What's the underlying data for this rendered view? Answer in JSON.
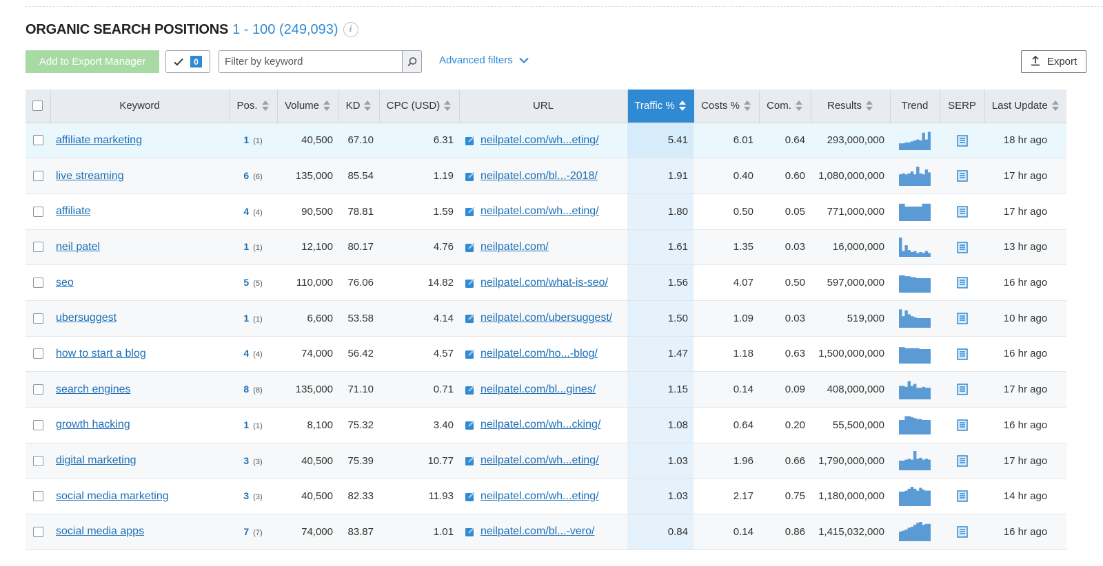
{
  "header": {
    "title": "ORGANIC SEARCH POSITIONS",
    "range": "1 - 100 (249,093)",
    "info_icon": "info-icon"
  },
  "toolbar": {
    "add_to_export_label": "Add to Export Manager",
    "selected_count": "0",
    "filter_placeholder": "Filter by keyword",
    "advanced_filters_label": "Advanced filters",
    "export_label": "Export"
  },
  "colors": {
    "accent": "#2f8ad3",
    "link": "#1c6fb7",
    "export_manager_btn": "#a8dba3",
    "trend_bars": "#5b9bd5"
  },
  "table": {
    "columns": {
      "keyword": "Keyword",
      "pos": "Pos.",
      "volume": "Volume",
      "kd": "KD",
      "cpc": "CPC (USD)",
      "url": "URL",
      "traffic": "Traffic %",
      "costs": "Costs %",
      "com": "Com.",
      "results": "Results",
      "trend": "Trend",
      "serp": "SERP",
      "last_update": "Last Update"
    },
    "sorted_column": "traffic",
    "rows": [
      {
        "keyword": "affiliate marketing",
        "pos": "1",
        "prev_pos": "(1)",
        "volume": "40,500",
        "kd": "67.10",
        "cpc": "6.31",
        "url": "neilpatel.com/wh...eting/",
        "traffic": "5.41",
        "costs": "6.01",
        "com": "0.64",
        "results": "293,000,000",
        "trend": [
          0.35,
          0.35,
          0.4,
          0.4,
          0.45,
          0.5,
          0.55,
          0.5,
          0.9,
          0.55,
          0.95
        ],
        "last_update": "18 hr ago"
      },
      {
        "keyword": "live streaming",
        "pos": "6",
        "prev_pos": "(6)",
        "volume": "135,000",
        "kd": "85.54",
        "cpc": "1.19",
        "url": "neilpatel.com/bl...-2018/",
        "traffic": "1.91",
        "costs": "0.40",
        "com": "0.60",
        "results": "1,080,000,000",
        "trend": [
          0.6,
          0.65,
          0.6,
          0.65,
          0.75,
          0.6,
          1.0,
          0.65,
          0.6,
          0.85,
          0.7
        ],
        "last_update": "17 hr ago"
      },
      {
        "keyword": "affiliate",
        "pos": "4",
        "prev_pos": "(4)",
        "volume": "90,500",
        "kd": "78.81",
        "cpc": "1.59",
        "url": "neilpatel.com/wh...eting/",
        "traffic": "1.80",
        "costs": "0.50",
        "com": "0.05",
        "results": "771,000,000",
        "trend": [
          0.9,
          0.9,
          0.75,
          0.75,
          0.75,
          0.75,
          0.75,
          0.75,
          0.9,
          0.9,
          0.9
        ],
        "last_update": "17 hr ago"
      },
      {
        "keyword": "neil patel",
        "pos": "1",
        "prev_pos": "(1)",
        "volume": "12,100",
        "kd": "80.17",
        "cpc": "4.76",
        "url": "neilpatel.com/",
        "traffic": "1.61",
        "costs": "1.35",
        "com": "0.03",
        "results": "16,000,000",
        "trend": [
          1.0,
          0.3,
          0.6,
          0.35,
          0.25,
          0.3,
          0.2,
          0.25,
          0.2,
          0.3,
          0.2
        ],
        "last_update": "13 hr ago"
      },
      {
        "keyword": "seo",
        "pos": "5",
        "prev_pos": "(5)",
        "volume": "110,000",
        "kd": "76.06",
        "cpc": "14.82",
        "url": "neilpatel.com/what-is-seo/",
        "traffic": "1.56",
        "costs": "4.07",
        "com": "0.50",
        "results": "597,000,000",
        "trend": [
          0.9,
          0.9,
          0.85,
          0.85,
          0.8,
          0.8,
          0.75,
          0.75,
          0.75,
          0.75,
          0.75
        ],
        "last_update": "16 hr ago"
      },
      {
        "keyword": "ubersuggest",
        "pos": "1",
        "prev_pos": "(1)",
        "volume": "6,600",
        "kd": "53.58",
        "cpc": "4.14",
        "url": "neilpatel.com/ubersuggest/",
        "traffic": "1.50",
        "costs": "1.09",
        "com": "0.03",
        "results": "519,000",
        "trend": [
          0.95,
          0.6,
          0.9,
          0.7,
          0.6,
          0.55,
          0.5,
          0.5,
          0.5,
          0.5,
          0.5
        ],
        "last_update": "10 hr ago"
      },
      {
        "keyword": "how to start a blog",
        "pos": "4",
        "prev_pos": "(4)",
        "volume": "74,000",
        "kd": "56.42",
        "cpc": "4.57",
        "url": "neilpatel.com/ho...-blog/",
        "traffic": "1.47",
        "costs": "1.18",
        "com": "0.63",
        "results": "1,500,000,000",
        "trend": [
          0.85,
          0.85,
          0.8,
          0.8,
          0.8,
          0.8,
          0.8,
          0.75,
          0.75,
          0.75,
          0.75
        ],
        "last_update": "16 hr ago"
      },
      {
        "keyword": "search engines",
        "pos": "8",
        "prev_pos": "(8)",
        "volume": "135,000",
        "kd": "71.10",
        "cpc": "0.71",
        "url": "neilpatel.com/bl...gines/",
        "traffic": "1.15",
        "costs": "0.14",
        "com": "0.09",
        "results": "408,000,000",
        "trend": [
          0.7,
          0.7,
          0.65,
          0.95,
          0.7,
          0.8,
          0.6,
          0.6,
          0.65,
          0.6,
          0.6
        ],
        "last_update": "17 hr ago"
      },
      {
        "keyword": "growth hacking",
        "pos": "1",
        "prev_pos": "(1)",
        "volume": "8,100",
        "kd": "75.32",
        "cpc": "3.40",
        "url": "neilpatel.com/wh...cking/",
        "traffic": "1.08",
        "costs": "0.64",
        "com": "0.20",
        "results": "55,500,000",
        "trend": [
          0.75,
          0.75,
          0.95,
          0.95,
          0.9,
          0.85,
          0.8,
          0.8,
          0.75,
          0.75,
          0.75
        ],
        "last_update": "16 hr ago"
      },
      {
        "keyword": "digital marketing",
        "pos": "3",
        "prev_pos": "(3)",
        "volume": "40,500",
        "kd": "75.39",
        "cpc": "10.77",
        "url": "neilpatel.com/wh...eting/",
        "traffic": "1.03",
        "costs": "1.96",
        "com": "0.66",
        "results": "1,790,000,000",
        "trend": [
          0.5,
          0.5,
          0.55,
          0.6,
          0.55,
          1.0,
          0.6,
          0.65,
          0.55,
          0.6,
          0.55
        ],
        "last_update": "17 hr ago"
      },
      {
        "keyword": "social media marketing",
        "pos": "3",
        "prev_pos": "(3)",
        "volume": "40,500",
        "kd": "82.33",
        "cpc": "11.93",
        "url": "neilpatel.com/wh...eting/",
        "traffic": "1.03",
        "costs": "2.17",
        "com": "0.75",
        "results": "1,180,000,000",
        "trend": [
          0.75,
          0.75,
          0.8,
          0.9,
          1.0,
          0.9,
          0.8,
          0.95,
          0.85,
          0.8,
          0.8
        ],
        "last_update": "14 hr ago"
      },
      {
        "keyword": "social media apps",
        "pos": "7",
        "prev_pos": "(7)",
        "volume": "74,000",
        "kd": "83.87",
        "cpc": "1.01",
        "url": "neilpatel.com/bl...-vero/",
        "traffic": "0.84",
        "costs": "0.14",
        "com": "0.86",
        "results": "1,415,032,000",
        "trend": [
          0.5,
          0.55,
          0.6,
          0.7,
          0.75,
          0.85,
          0.95,
          1.0,
          0.85,
          0.9,
          0.9
        ],
        "last_update": "16 hr ago"
      }
    ]
  }
}
